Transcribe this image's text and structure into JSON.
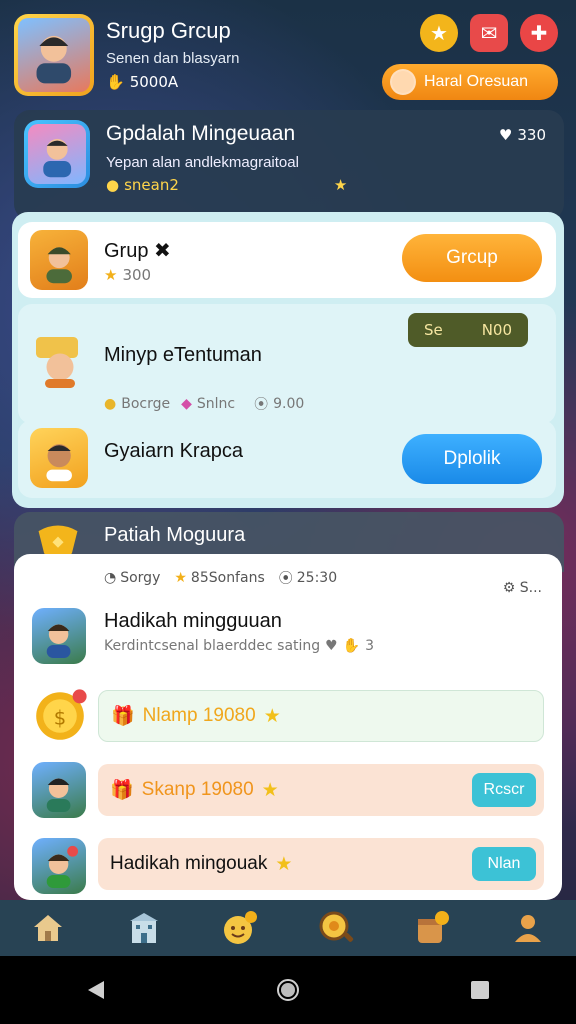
{
  "header": {
    "title": "Srugp Grcup",
    "subtitle": "Senen dan blasyarn",
    "coins": "5000A",
    "promo_label": "Haral Oresuan"
  },
  "weekly": {
    "title": "Gpdalah Mingeuaan",
    "desc": "Yepan alan andlekmagraitoal",
    "coins": "snean2",
    "likes": "330"
  },
  "rows": [
    {
      "title": "Grup",
      "sub": "300",
      "button": "Grcup"
    },
    {
      "title": "Minyp eTentuman",
      "tag_left": "Se",
      "tag_right": "N00",
      "stat1": "Bocrge",
      "stat2": "Snlnc",
      "stat3": "9.00"
    },
    {
      "title": "Gyaiarn Krapca",
      "button": "Dplolik"
    }
  ],
  "section": {
    "title": "Patiah Moguura",
    "stats": [
      "Sorgy",
      "85Sonfans",
      "25:30"
    ],
    "mini": "S..."
  },
  "list": {
    "item1_title": "Hadikah mingguuan",
    "item1_sub": "Kerdintcsenal blaerddec sating",
    "item1_count": "3",
    "reward1": "Nlamp 19080",
    "reward2": "Skanp 19080",
    "reward2_btn": "Rcscr",
    "item3_title": "Hadikah mingouak",
    "item3_btn": "Nlan"
  },
  "colors": {
    "accent_orange": "#f59a1e",
    "accent_blue": "#1f92ee",
    "teal_button": "#3cc2d6"
  },
  "icons": [
    "star-icon",
    "mail-icon",
    "puzzle-icon",
    "heart-icon",
    "home-icon",
    "building-icon",
    "face-icon",
    "search-coin-icon",
    "bag-icon",
    "profile-icon"
  ]
}
